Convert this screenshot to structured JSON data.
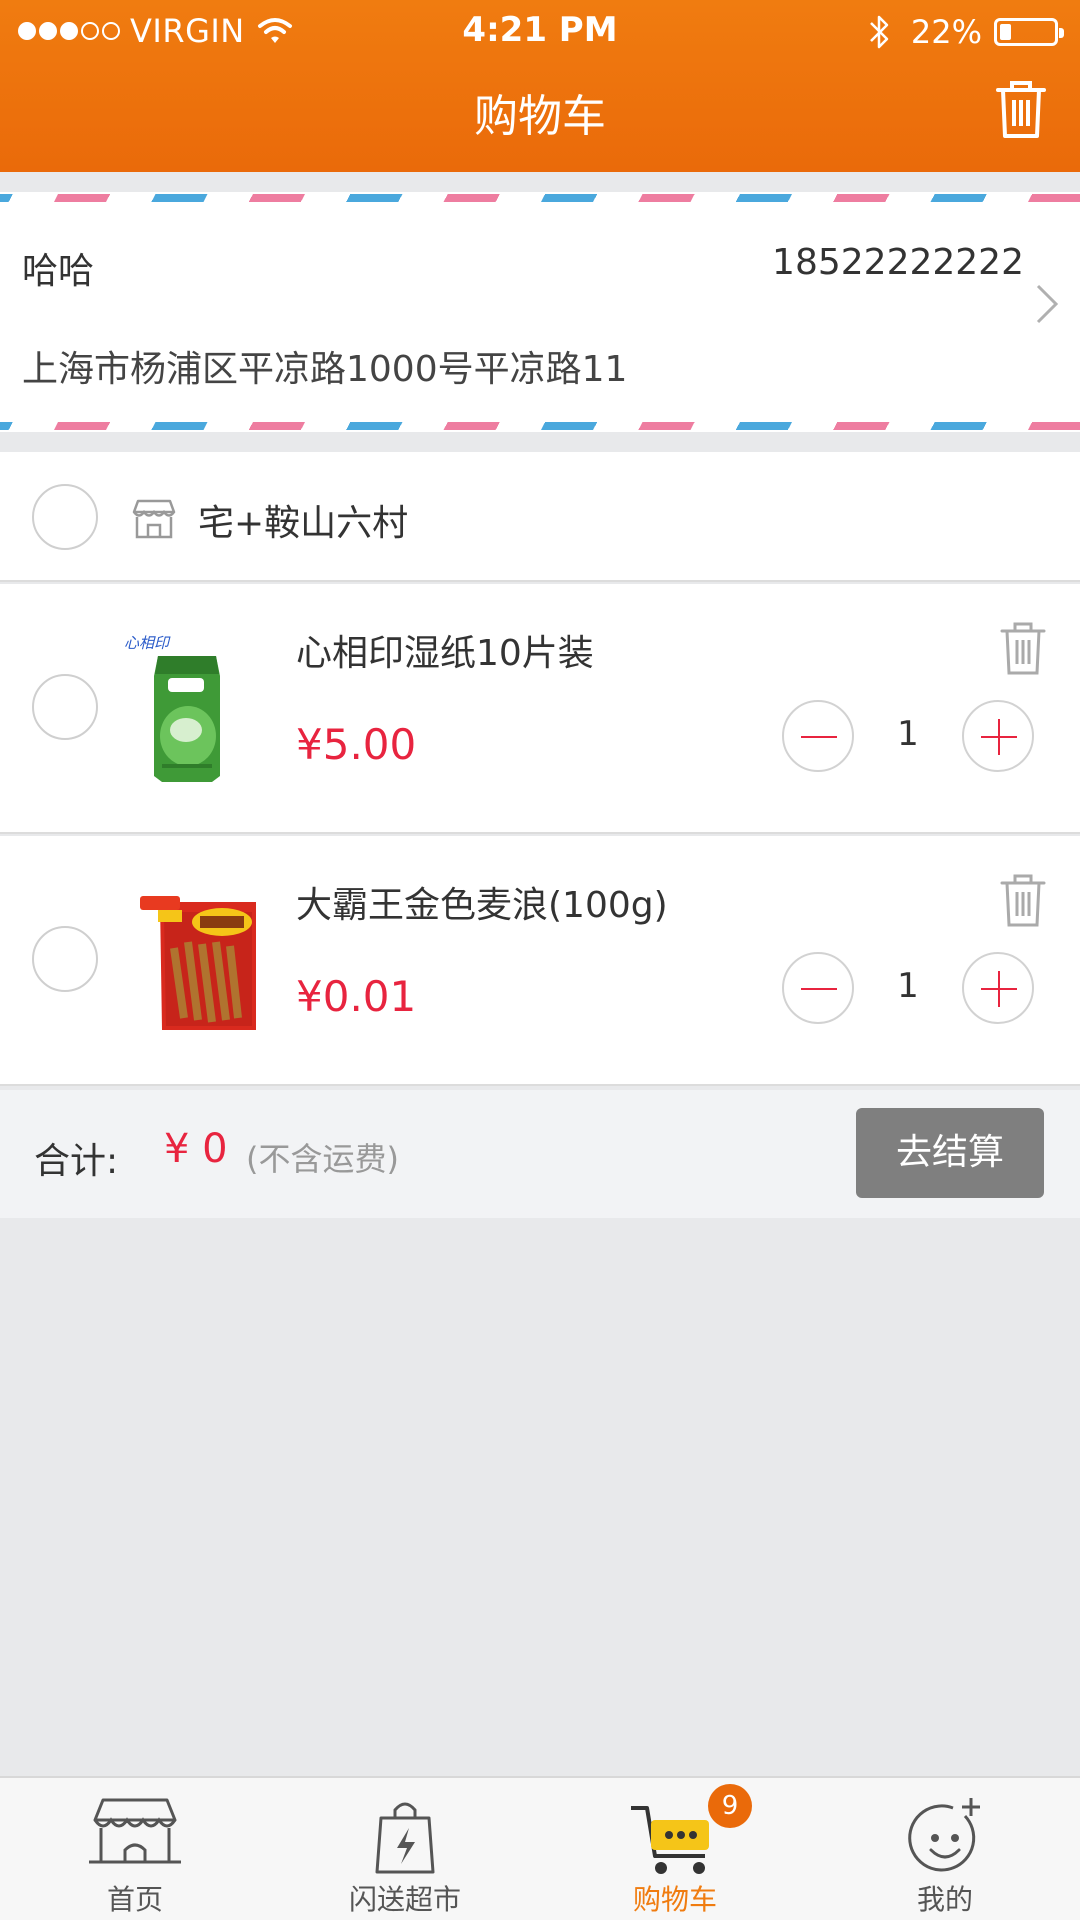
{
  "status_bar": {
    "carrier": "VIRGIN",
    "time": "4:21 PM",
    "battery_percent": "22%",
    "battery_level": 0.22,
    "signal_bars_filled": 3,
    "signal_bars_total": 5
  },
  "header": {
    "title": "购物车",
    "trash_icon": "trash-icon"
  },
  "address": {
    "name": "哈哈",
    "phone": "18522222222",
    "line": "上海市杨浦区平凉路1000号平凉路11"
  },
  "store": {
    "name": "宅+鞍山六村",
    "icon": "store-icon"
  },
  "items": [
    {
      "name": "心相印湿纸10片装",
      "price": "¥5.00",
      "quantity": "1"
    },
    {
      "name": "大霸王金色麦浪(100g)",
      "price": "¥0.01",
      "quantity": "1"
    }
  ],
  "total": {
    "label": "合计:",
    "value": "¥ 0",
    "note": "(不含运费)",
    "checkout_label": "去结算"
  },
  "tabs": [
    {
      "label": "首页",
      "icon": "storefront-icon"
    },
    {
      "label": "闪送超市",
      "icon": "shopping-bag-icon"
    },
    {
      "label": "购物车",
      "icon": "cart-icon",
      "badge": "9",
      "active": true
    },
    {
      "label": "我的",
      "icon": "smiley-icon"
    }
  ],
  "colors": {
    "header_orange": "#f07c10",
    "price_red": "#e8243f",
    "checkout_gray": "#7f7f7f",
    "active_tab": "#f07c10"
  }
}
